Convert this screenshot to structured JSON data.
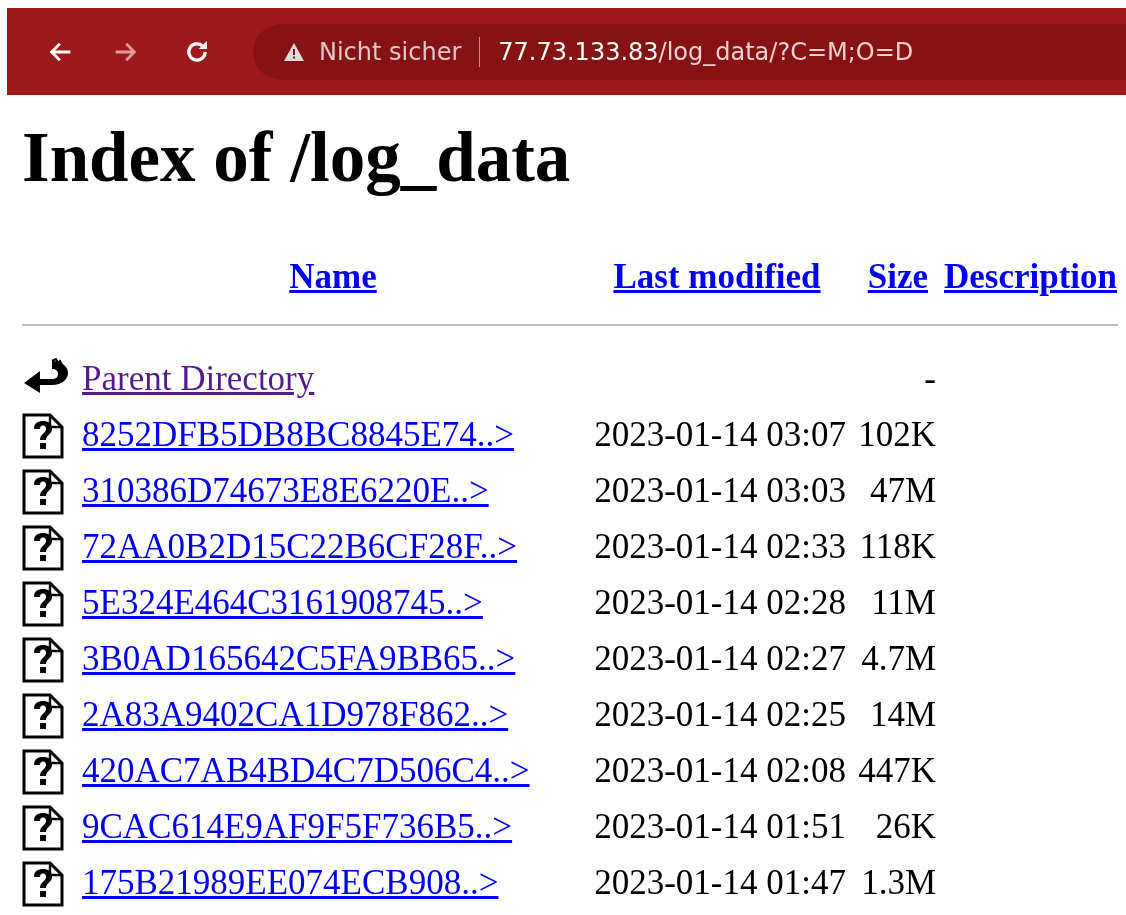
{
  "browser": {
    "security_label": "Nicht sicher",
    "url_host": "77.73.133.83",
    "url_path": "/log_data/?C=M;O=D"
  },
  "page": {
    "title": "Index of /log_data"
  },
  "columns": [
    "Name",
    "Last modified",
    "Size",
    "Description"
  ],
  "rows": [
    {
      "kind": "parent",
      "name": "Parent Directory",
      "visited": true,
      "size": "-"
    },
    {
      "kind": "file",
      "name": "8252DFB5DB8BC8845E74..>",
      "visited": false,
      "date": "2023-01-14 03:07",
      "size": "102K"
    },
    {
      "kind": "file",
      "name": "310386D74673E8E6220E..>",
      "visited": false,
      "date": "2023-01-14 03:03",
      "size": "47M"
    },
    {
      "kind": "file",
      "name": "72AA0B2D15C22B6CF28F..>",
      "visited": false,
      "date": "2023-01-14 02:33",
      "size": "118K"
    },
    {
      "kind": "file",
      "name": "5E324E464C3161908745..>",
      "visited": false,
      "date": "2023-01-14 02:28",
      "size": "11M"
    },
    {
      "kind": "file",
      "name": "3B0AD165642C5FA9BB65..>",
      "visited": false,
      "date": "2023-01-14 02:27",
      "size": "4.7M"
    },
    {
      "kind": "file",
      "name": "2A83A9402CA1D978F862..>",
      "visited": false,
      "date": "2023-01-14 02:25",
      "size": "14M"
    },
    {
      "kind": "file",
      "name": "420AC7AB4BD4C7D506C4..>",
      "visited": false,
      "date": "2023-01-14 02:08",
      "size": "447K"
    },
    {
      "kind": "file",
      "name": "9CAC614E9AF9F5F736B5..>",
      "visited": false,
      "date": "2023-01-14 01:51",
      "size": "26K"
    },
    {
      "kind": "file",
      "name": "175B21989EE074ECB908..>",
      "visited": false,
      "date": "2023-01-14 01:47",
      "size": "1.3M"
    }
  ]
}
